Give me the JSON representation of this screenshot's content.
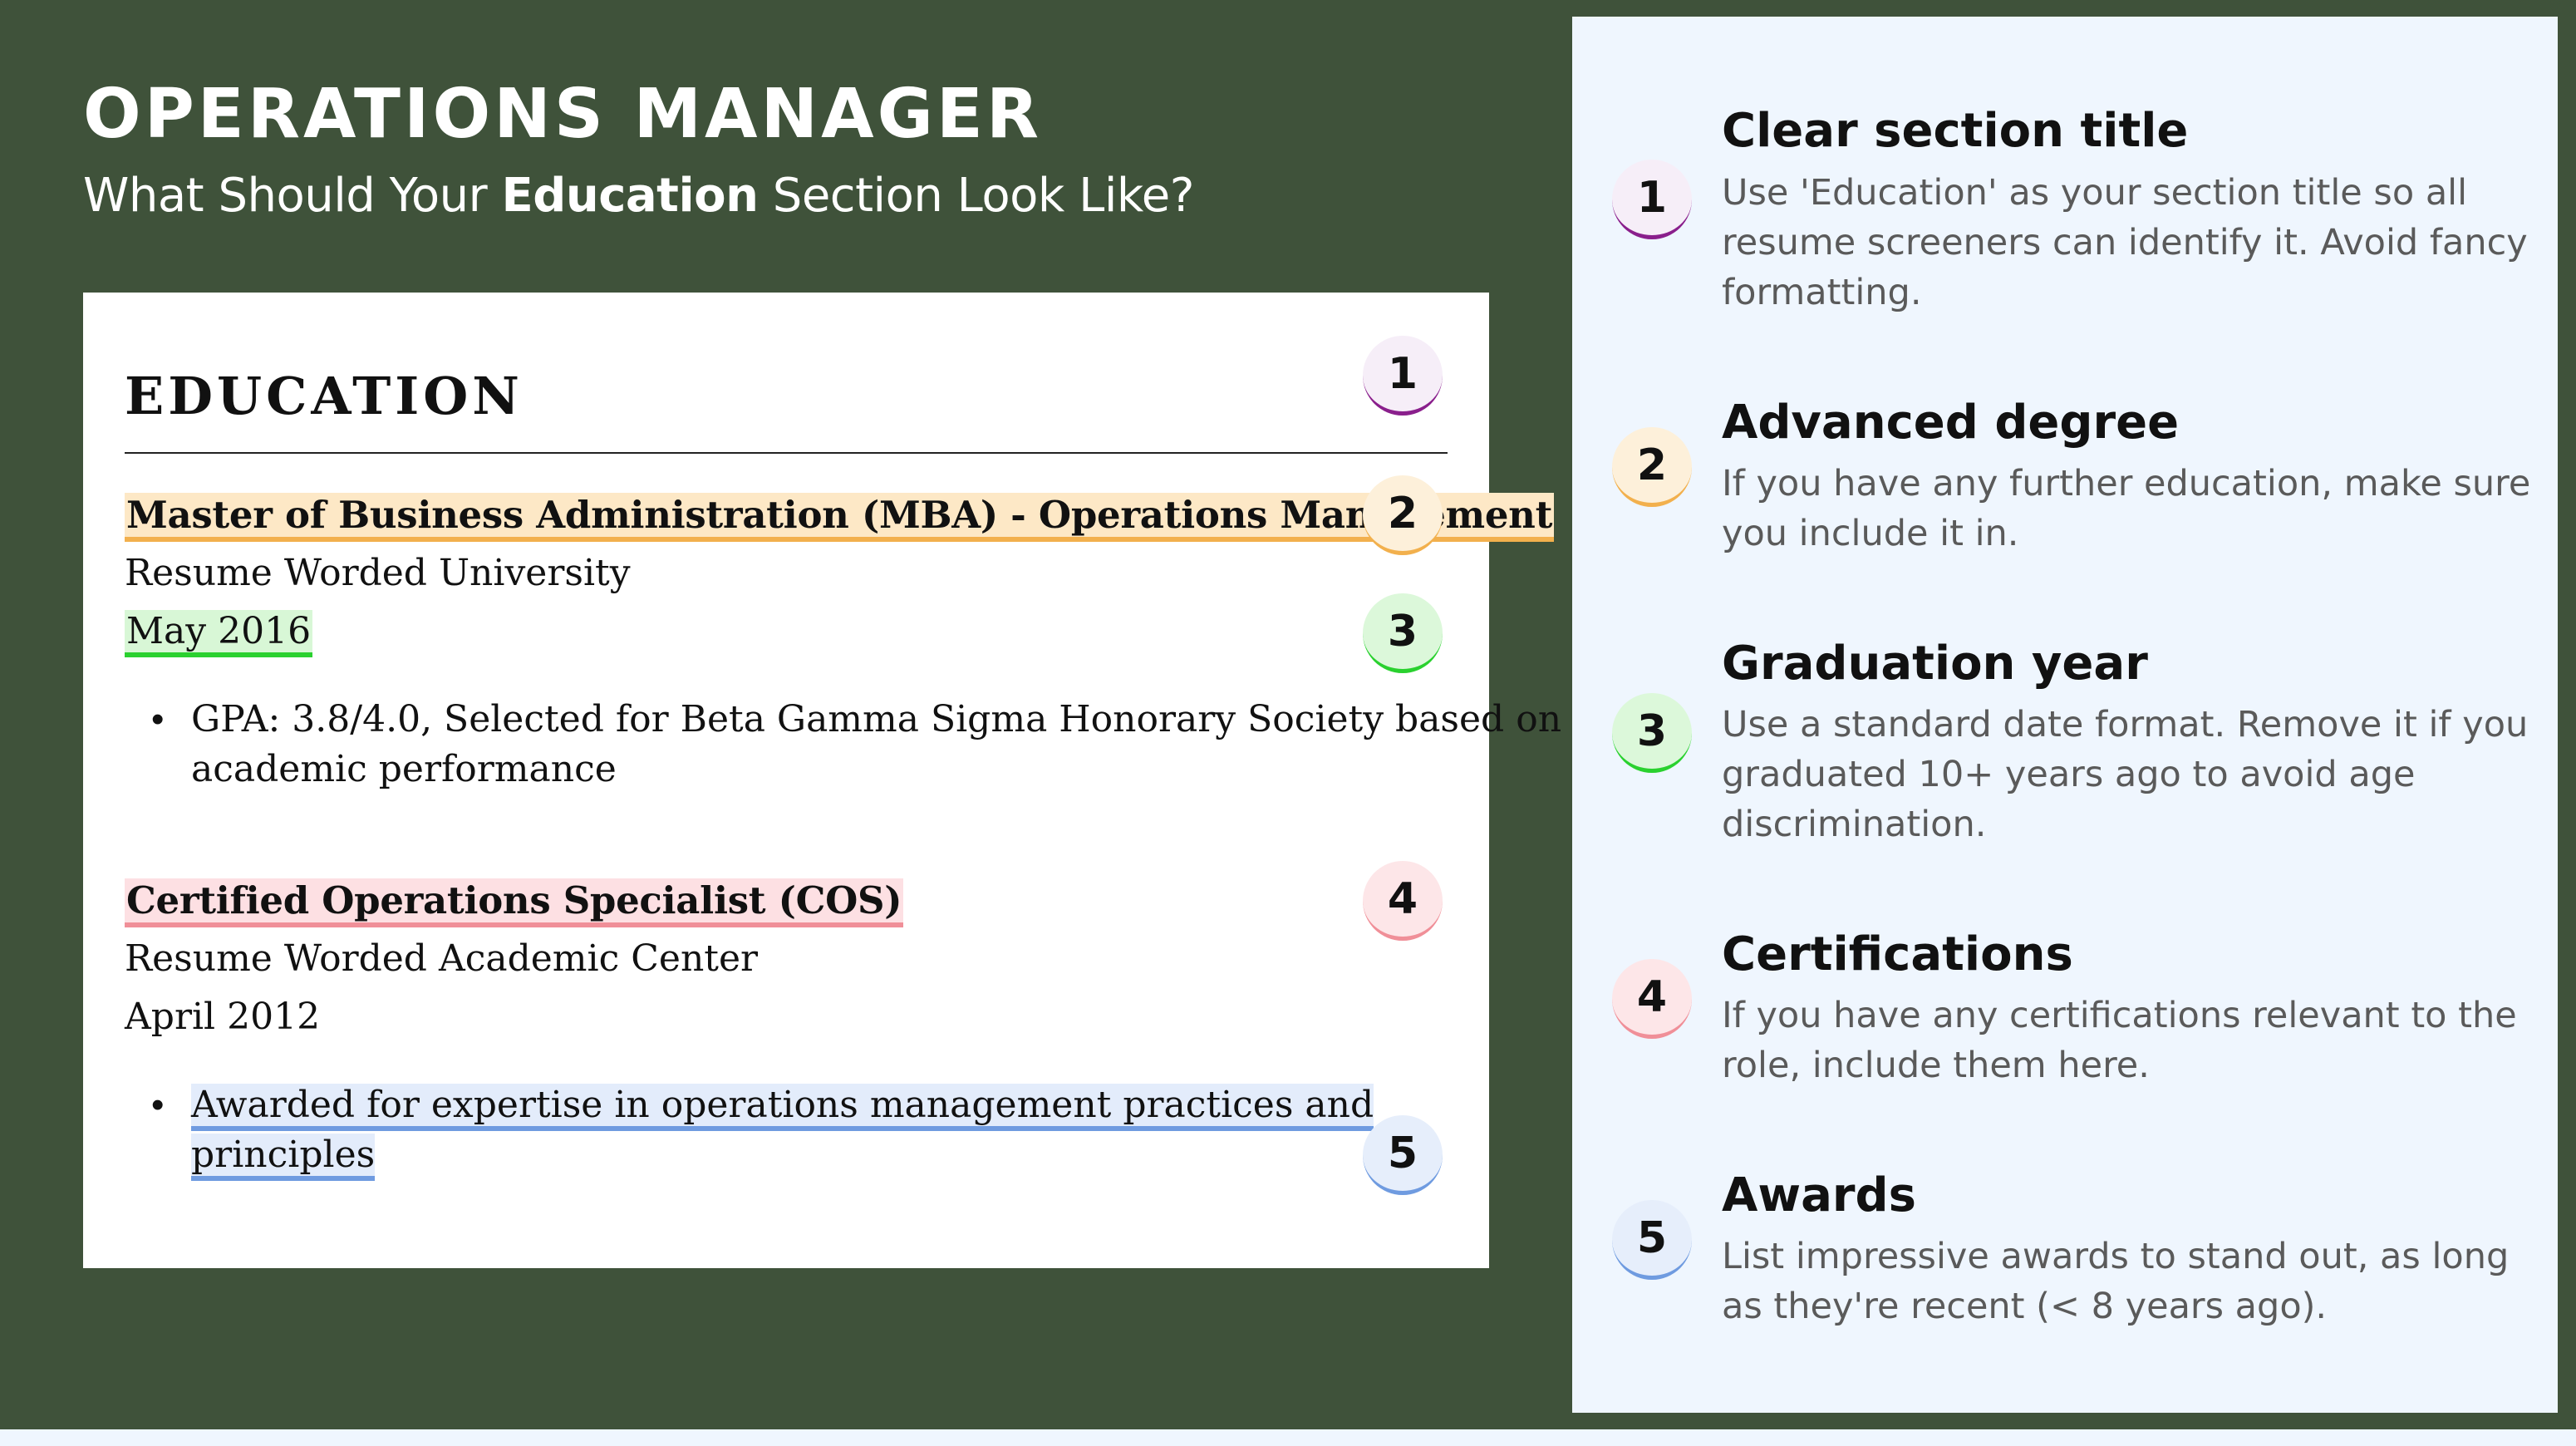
{
  "header": {
    "title": "OPERATIONS MANAGER",
    "subtitle_before": "What Should Your ",
    "subtitle_bold": "Education",
    "subtitle_after": " Section Look Like?"
  },
  "resume": {
    "section_title": "EDUCATION",
    "entries": [
      {
        "degree": "Master of Business Administration (MBA) - Operations Management",
        "institution": "Resume Worded University",
        "date": "May 2016",
        "bullet_line1": "GPA: 3.8/4.0, Selected for Beta Gamma Sigma Honorary Society based on",
        "bullet_line2": "academic performance"
      },
      {
        "degree": "Certified Operations Specialist (COS)",
        "institution": "Resume Worded Academic Center",
        "date": "April 2012",
        "bullet_line1": "Awarded for expertise in operations management practices and",
        "bullet_line2": "principles"
      }
    ],
    "badges": [
      "1",
      "2",
      "3",
      "4",
      "5"
    ]
  },
  "tips": [
    {
      "number": "1",
      "title": "Clear section title",
      "text": "Use 'Education' as your section title so all resume screeners can identify it. Avoid fancy formatting."
    },
    {
      "number": "2",
      "title": "Advanced degree",
      "text": "If you have any further education, make sure you include it in."
    },
    {
      "number": "3",
      "title": "Graduation year",
      "text": "Use a standard date format. Remove it if you graduated 10+ years ago to avoid age discrimination."
    },
    {
      "number": "4",
      "title": "Certifications",
      "text": "If you have any certifications relevant to the role, include them here."
    },
    {
      "number": "5",
      "title": "Awards",
      "text": "List impressive awards to stand out, as long as they're recent (< 8 years ago)."
    }
  ],
  "colors": {
    "background": "#3f523a",
    "panel": "#eff6fe",
    "badge1": "#8a1f8c",
    "badge2": "#f2b04d",
    "badge3": "#2ad12f",
    "badge4": "#f08f98",
    "badge5": "#6f9be0"
  }
}
